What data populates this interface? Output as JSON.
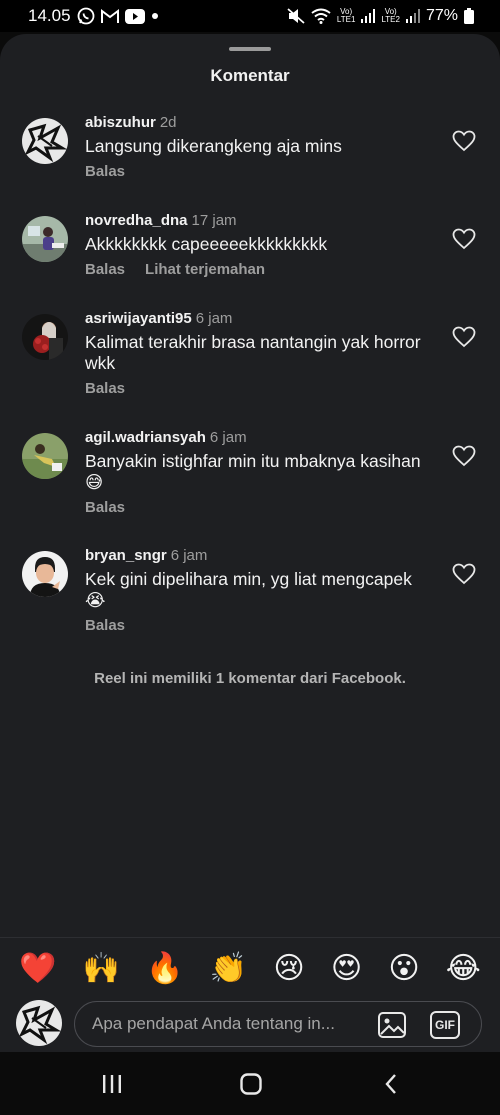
{
  "status_bar": {
    "time": "14.05",
    "battery": "77%",
    "sim1_label": "Vo)\nLTE1",
    "sim2_label": "Vo)\nLTE2"
  },
  "sheet": {
    "title": "Komentar"
  },
  "comments": [
    {
      "username": "abiszuhur",
      "time": "2d",
      "text": "Langsung dikerangkeng aja mins",
      "reply": "Balas",
      "translate": ""
    },
    {
      "username": "novredha_dna",
      "time": "17 jam",
      "text": "Akkkkkkkk capeeeeekkkkkkkkk",
      "reply": "Balas",
      "translate": "Lihat terjemahan"
    },
    {
      "username": "asriwijayanti95",
      "time": "6 jam",
      "text": "Kalimat terakhir brasa nantangin yak horror wkk",
      "reply": "Balas",
      "translate": ""
    },
    {
      "username": "agil.wadriansyah",
      "time": "6 jam",
      "text": "Banyakin istighfar min itu mbaknya kasihan😅",
      "reply": "Balas",
      "translate": ""
    },
    {
      "username": "bryan_sngr",
      "time": "6 jam",
      "text": "Kek gini dipelihara min, yg liat mengcapek 😭",
      "reply": "Balas",
      "translate": ""
    }
  ],
  "facebook_note": "Reel ini memiliki 1 komentar dari Facebook.",
  "emojis": [
    "❤️",
    "🙌",
    "🔥",
    "👏",
    "😢",
    "😍",
    "😮",
    "😂"
  ],
  "input": {
    "placeholder": "Apa pendapat Anda tentang in...",
    "gif_label": "GIF"
  },
  "icons": {
    "like": "heart-outline-icon",
    "image": "image-icon",
    "gif": "gif-icon",
    "nav_recent": "recent-apps-icon",
    "nav_home": "home-icon",
    "nav_back": "back-icon"
  }
}
